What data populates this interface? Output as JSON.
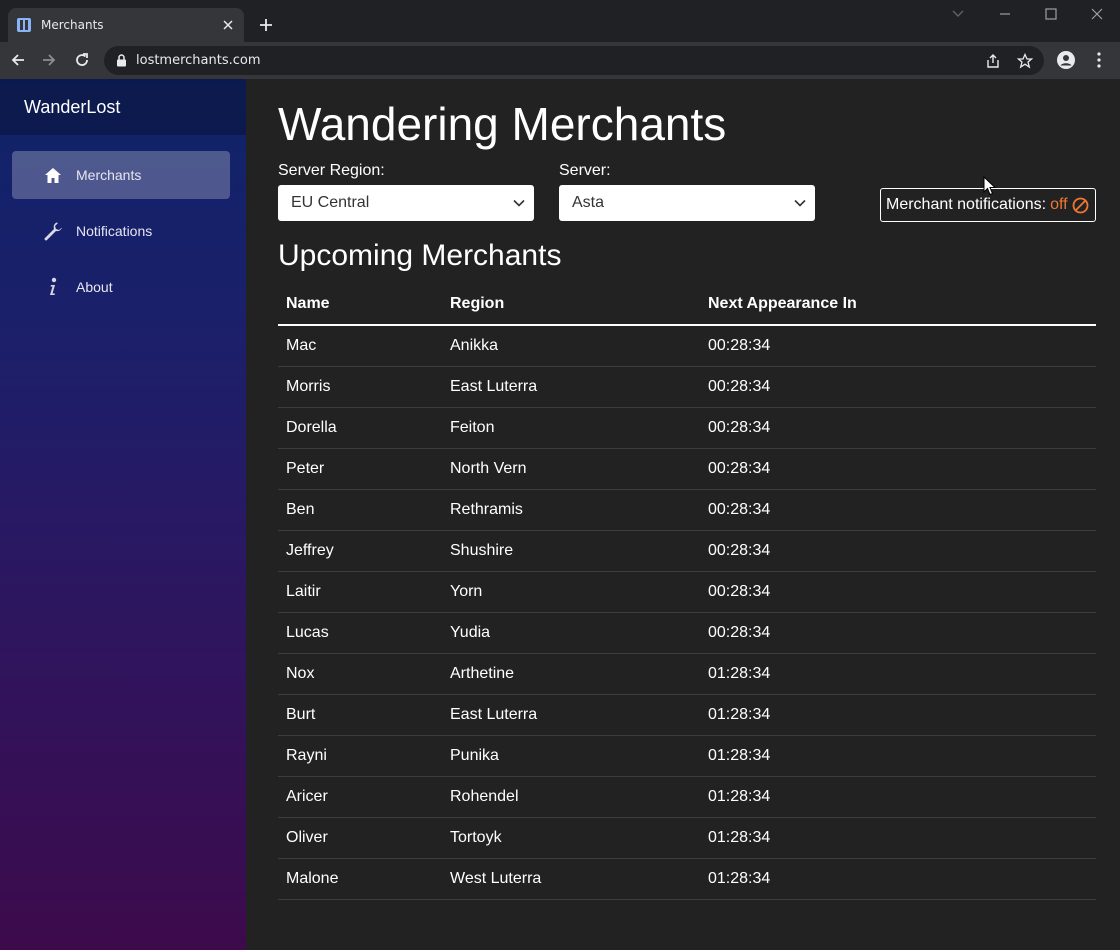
{
  "browser": {
    "tab_title": "Merchants",
    "url": "lostmerchants.com",
    "icons": [
      "page-favicon",
      "close-icon",
      "plus-icon",
      "chevron-down-icon",
      "minimize-icon",
      "maximize-icon",
      "close-window-icon",
      "back-arrow-icon",
      "forward-arrow-icon",
      "reload-icon",
      "lock-icon",
      "share-icon",
      "star-icon",
      "profile-icon",
      "kebab-menu-icon"
    ]
  },
  "sidebar": {
    "brand": "WanderLost",
    "items": [
      {
        "label": "Merchants",
        "icon": "home-icon",
        "active": true
      },
      {
        "label": "Notifications",
        "icon": "wrench-icon",
        "active": false
      },
      {
        "label": "About",
        "icon": "info-icon",
        "active": false
      }
    ]
  },
  "main": {
    "title": "Wandering Merchants",
    "region_label": "Server Region:",
    "region_value": "EU Central",
    "server_label": "Server:",
    "server_value": "Asta",
    "notifications_label": "Merchant notifications:",
    "notifications_state": "off",
    "notifications_state_color": "#ee7733",
    "subtitle": "Upcoming Merchants",
    "table": {
      "headers": [
        "Name",
        "Region",
        "Next Appearance In"
      ],
      "rows": [
        [
          "Mac",
          "Anikka",
          "00:28:34"
        ],
        [
          "Morris",
          "East Luterra",
          "00:28:34"
        ],
        [
          "Dorella",
          "Feiton",
          "00:28:34"
        ],
        [
          "Peter",
          "North Vern",
          "00:28:34"
        ],
        [
          "Ben",
          "Rethramis",
          "00:28:34"
        ],
        [
          "Jeffrey",
          "Shushire",
          "00:28:34"
        ],
        [
          "Laitir",
          "Yorn",
          "00:28:34"
        ],
        [
          "Lucas",
          "Yudia",
          "00:28:34"
        ],
        [
          "Nox",
          "Arthetine",
          "01:28:34"
        ],
        [
          "Burt",
          "East Luterra",
          "01:28:34"
        ],
        [
          "Rayni",
          "Punika",
          "01:28:34"
        ],
        [
          "Aricer",
          "Rohendel",
          "01:28:34"
        ],
        [
          "Oliver",
          "Tortoyk",
          "01:28:34"
        ],
        [
          "Malone",
          "West Luterra",
          "01:28:34"
        ]
      ]
    }
  }
}
